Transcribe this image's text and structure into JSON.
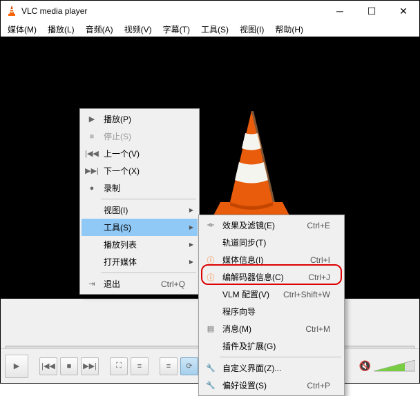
{
  "window": {
    "title": "VLC media player"
  },
  "menubar": [
    "媒体(M)",
    "播放(L)",
    "音频(A)",
    "视频(V)",
    "字幕(T)",
    "工具(S)",
    "视图(I)",
    "帮助(H)"
  ],
  "ctrl": {
    "play": "▶",
    "prev": "|◀◀",
    "stop": "■",
    "next": "▶▶|",
    "fs": "⛶",
    "ext": "≡",
    "pl": "≡",
    "loop": "⟳",
    "shuf": "✕",
    "time": "--:--",
    "mute": "🔇"
  },
  "ctx1": [
    {
      "icon": "▶",
      "label": "播放(P)",
      "sub": false
    },
    {
      "icon": "■",
      "label": "停止(S)",
      "sub": false,
      "dim": true
    },
    {
      "icon": "|◀◀",
      "label": "上一个(V)",
      "sub": false
    },
    {
      "icon": "▶▶|",
      "label": "下一个(X)",
      "sub": false
    },
    {
      "icon": "●",
      "label": "录制",
      "sub": false
    },
    {
      "sep": true
    },
    {
      "icon": "",
      "label": "视图(I)",
      "sub": true
    },
    {
      "icon": "",
      "label": "工具(S)",
      "sub": true,
      "hl": true
    },
    {
      "icon": "",
      "label": "播放列表",
      "sub": true
    },
    {
      "icon": "",
      "label": "打开媒体",
      "sub": true
    },
    {
      "sep": true
    },
    {
      "icon": "⇥",
      "label": "退出",
      "shortcut": "Ctrl+Q"
    }
  ],
  "ctx2": [
    {
      "icon": "⟛",
      "label": "效果及滤镜(E)",
      "shortcut": "Ctrl+E"
    },
    {
      "icon": "",
      "label": "轨道同步(T)",
      "shortcut": ""
    },
    {
      "icon": "ⓘ",
      "label": "媒体信息(I)",
      "shortcut": "Ctrl+I",
      "orange": true
    },
    {
      "icon": "ⓘ",
      "label": "编解码器信息(C)",
      "shortcut": "Ctrl+J",
      "orange": true
    },
    {
      "icon": "",
      "label": "VLM 配置(V)",
      "shortcut": "Ctrl+Shift+W"
    },
    {
      "icon": "",
      "label": "程序向导",
      "shortcut": ""
    },
    {
      "icon": "▤",
      "label": "消息(M)",
      "shortcut": "Ctrl+M"
    },
    {
      "icon": "",
      "label": "插件及扩展(G)",
      "shortcut": ""
    },
    {
      "sep": true
    },
    {
      "icon": "🔧",
      "label": "自定义界面(Z)...",
      "shortcut": ""
    },
    {
      "icon": "🔧",
      "label": "偏好设置(S)",
      "shortcut": "Ctrl+P"
    }
  ]
}
